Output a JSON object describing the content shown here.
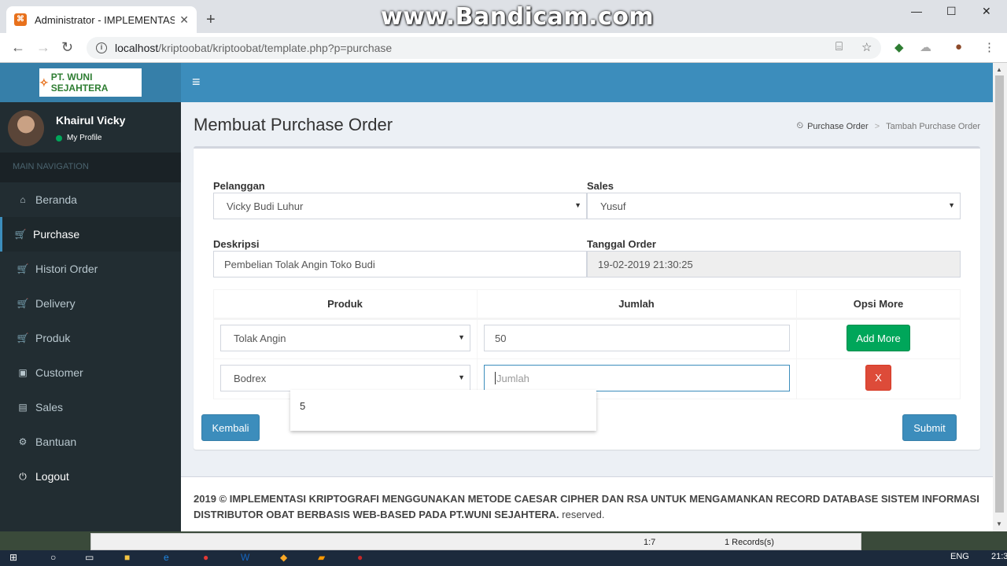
{
  "browser": {
    "tab_title": "Administrator - IMPLEMENTASI K",
    "new_tab": "+",
    "watermark": "www.Bandicam.com",
    "url_host": "localhost",
    "url_path": "/kriptoobat/kriptoobat/template.php?p=purchase"
  },
  "app": {
    "logo_text": "PT. WUNI SEJAHTERA",
    "user": {
      "name": "Khairul Vicky",
      "status": "My Profile"
    },
    "nav_header": "MAIN NAVIGATION",
    "nav": [
      {
        "label": "Beranda",
        "icon": "home-icon"
      },
      {
        "label": "Purchase",
        "icon": "cart-icon"
      },
      {
        "label": "Histori Order",
        "icon": "cart-icon"
      },
      {
        "label": "Delivery",
        "icon": "cart-icon"
      },
      {
        "label": "Produk",
        "icon": "cart-icon"
      },
      {
        "label": "Customer",
        "icon": "user-icon"
      },
      {
        "label": "Sales",
        "icon": "sales-icon"
      },
      {
        "label": "Bantuan",
        "icon": "gear-icon"
      },
      {
        "label": "Logout",
        "icon": "power-icon"
      }
    ],
    "page_title": "Membuat Purchase Order",
    "breadcrumb": {
      "root": "Purchase Order",
      "current": "Tambah Purchase Order"
    },
    "form": {
      "pelanggan_label": "Pelanggan",
      "pelanggan_value": "Vicky Budi Luhur",
      "sales_label": "Sales",
      "sales_value": "Yusuf",
      "deskripsi_label": "Deskripsi",
      "deskripsi_value": "Pembelian Tolak Angin Toko Budi",
      "tanggal_label": "Tanggal Order",
      "tanggal_value": "19-02-2019 21:30:25"
    },
    "table": {
      "headers": [
        "Produk",
        "Jumlah",
        "Opsi More"
      ],
      "rows": [
        {
          "produk": "Tolak Angin",
          "jumlah": "50",
          "action": "Add More"
        },
        {
          "produk": "Bodrex",
          "jumlah_placeholder": "Jumlah",
          "action": "X"
        }
      ],
      "autocomplete": "5"
    },
    "buttons": {
      "back": "Kembali",
      "submit": "Submit"
    },
    "footer": {
      "bold": "2019 © IMPLEMENTASI KRIPTOGRAFI MENGGUNAKAN METODE CAESAR CIPHER DAN RSA UNTUK MENGAMANKAN RECORD DATABASE SISTEM INFORMASI DISTRIBUTOR OBAT BERBASIS WEB-BASED PADA PT.WUNI SEJAHTERA.",
      "rest": " reserved."
    }
  },
  "statusbar": {
    "position": "1:7",
    "records": "1 Records(s)"
  },
  "taskbar": {
    "lang": "ENG",
    "time": "21:3"
  }
}
